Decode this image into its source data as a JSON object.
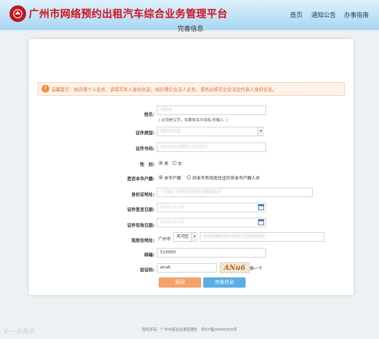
{
  "header": {
    "title": "广州市网络预约出租汽车综合业务管理平台",
    "nav": [
      "首页",
      "通知公告",
      "办事指南"
    ]
  },
  "card": {
    "title": "完善信息",
    "notice_icon": "!",
    "notice": "温馨提示：如办理个人业务，请填写本人身份信息；如办理企业法人业务，请务必填写企业法定代表人身份信息。"
  },
  "form": {
    "name_label": "姓名:",
    "name_value": "刘晓东",
    "name_hint": "( 必须是汉字，如果姓名中间有·的输入· )",
    "id_type_label": "证件类型:",
    "id_type_value": "居民身份证",
    "id_no_label": "证件号码:",
    "id_no_value": "440106198807150023",
    "gender_label": "性　别:",
    "gender_options": [
      "男",
      "女"
    ],
    "local_label": "是否本市户籍:",
    "local_options": [
      "本市户籍",
      "持本市有效居住证的非本市户籍人员"
    ],
    "id_addr_label": "身份证地址:",
    "id_addr_value": "广东省广州市天河区天河路某某号",
    "issue_label": "证件签发日期:",
    "issue_value": "2016-12-16",
    "valid_label": "证件有效日期:",
    "valid_value": "2026-12-16",
    "addr_label": "现居住地址:",
    "addr_city": "广州市",
    "addr_district": "天河区",
    "addr_detail": "林和西路某某号某某小区某栋某房",
    "postcode_label": "邮编:",
    "postcode_value": "510000",
    "captcha_label": "验证码:",
    "captcha_value": "anu6",
    "captcha_image": "ANu6",
    "captcha_refresh": "换一个"
  },
  "buttons": {
    "back": "返回",
    "submit": "完善信息"
  },
  "footer": "版权所有：广州市客运交通管理处　粤ICP备05045309号",
  "watermark": "K 一点资讯",
  "colors": {
    "brand_red": "#d0121b",
    "back_button": "#f5a26a",
    "submit_button": "#5aaee6",
    "notice_text": "#f06a28"
  }
}
